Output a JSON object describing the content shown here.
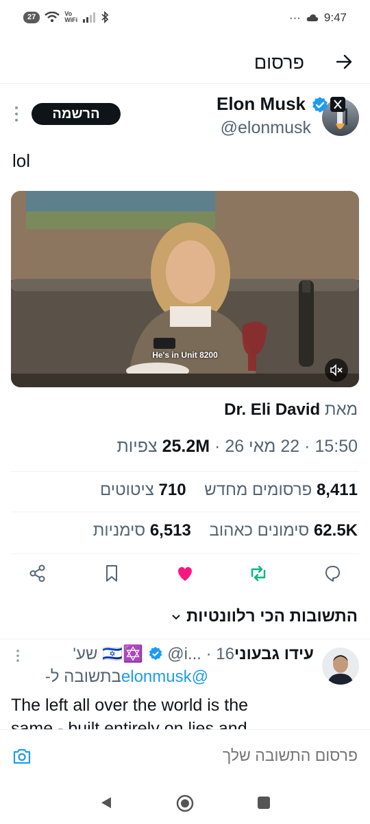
{
  "status_bar": {
    "badge": "27",
    "wifi_label_top": "Vo",
    "wifi_label_bottom": "WiFi",
    "dots": "···",
    "time": "9:47"
  },
  "header": {
    "title": "פרסום"
  },
  "post": {
    "author_name": "Elon Musk",
    "author_handle": "@elonmusk",
    "subscribe_label": "הרשמה",
    "text": "lol",
    "video_caption": "He's in Unit 8200",
    "from_prefix": "מאת",
    "from_name": "Dr. Eli David",
    "time": "15:50",
    "date": "22 מאי 26",
    "views_count": "25.2M",
    "views_label": "צפיות",
    "reposts_count": "8,411",
    "reposts_label": "פרסומים מחדש",
    "quotes_count": "710",
    "quotes_label": "ציטוטים",
    "likes_count": "62.5K",
    "likes_label": "סימונים כאהוב",
    "bookmarks_count": "6,513",
    "bookmarks_label": "סימניות"
  },
  "replies_section": {
    "sort_label": "התשובות הכי רלוונטיות"
  },
  "reply": {
    "author_name": "עידו גבעוני",
    "flags": "🇮🇱✡️",
    "handle": "@i...",
    "time": "16 שע'",
    "reply_to_prefix": "בתשובה ל-",
    "reply_to_handle": "@elonmusk",
    "text": "The left all over the world is the same - built entirely on lies and"
  },
  "composer": {
    "placeholder": "פרסום התשובה שלך"
  },
  "colors": {
    "accent": "#1d9bf0",
    "like": "#f91880",
    "repost": "#00ba7c",
    "text": "#0f1419",
    "muted": "#536471"
  }
}
